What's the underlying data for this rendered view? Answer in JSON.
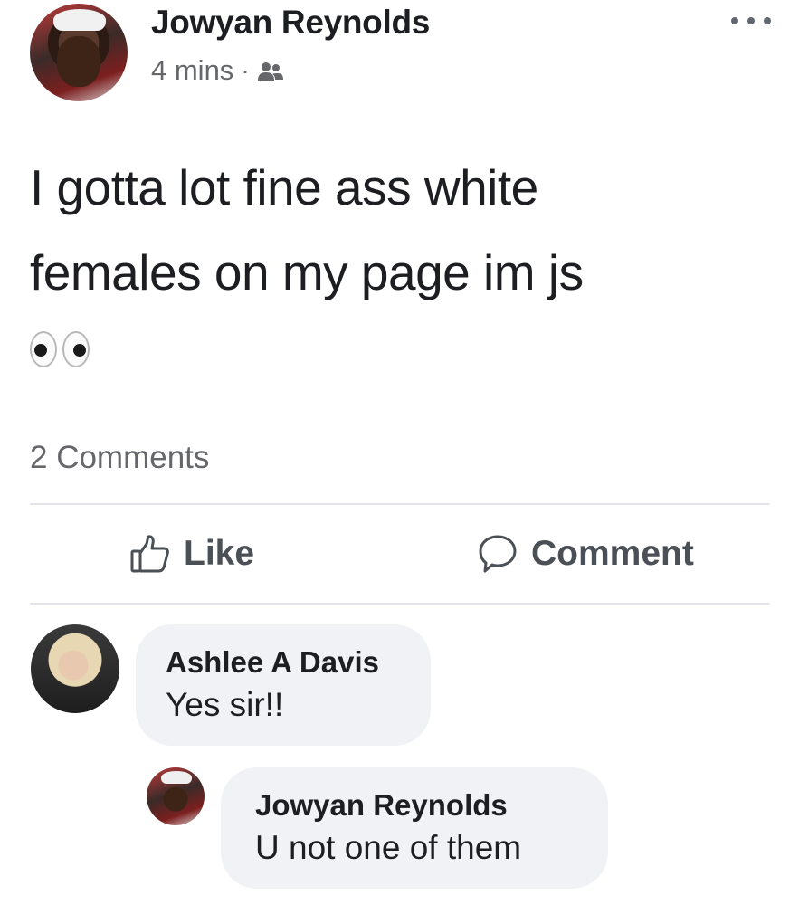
{
  "post": {
    "author": "Jowyan Reynolds",
    "timestamp": "4 mins",
    "separator": "·",
    "audience_icon": "friends-icon",
    "more_icon": "more-options-icon",
    "text_lines": [
      "I gotta lot fine ass white",
      "females on my page im js"
    ],
    "emoji": "eyes-emoji",
    "comments_count": "2 Comments"
  },
  "actions": {
    "like_label": "Like",
    "comment_label": "Comment"
  },
  "comments": [
    {
      "author": "Ashlee A Davis",
      "text": "Yes sir!!"
    },
    {
      "author": "Jowyan Reynolds",
      "text": "U not one of them",
      "is_reply": true
    }
  ],
  "colors": {
    "text_primary": "#1c1e21",
    "text_secondary": "#65676b",
    "bubble_bg": "#f0f2f5",
    "divider": "#e4e6eb",
    "action_text": "#4b4f56"
  }
}
